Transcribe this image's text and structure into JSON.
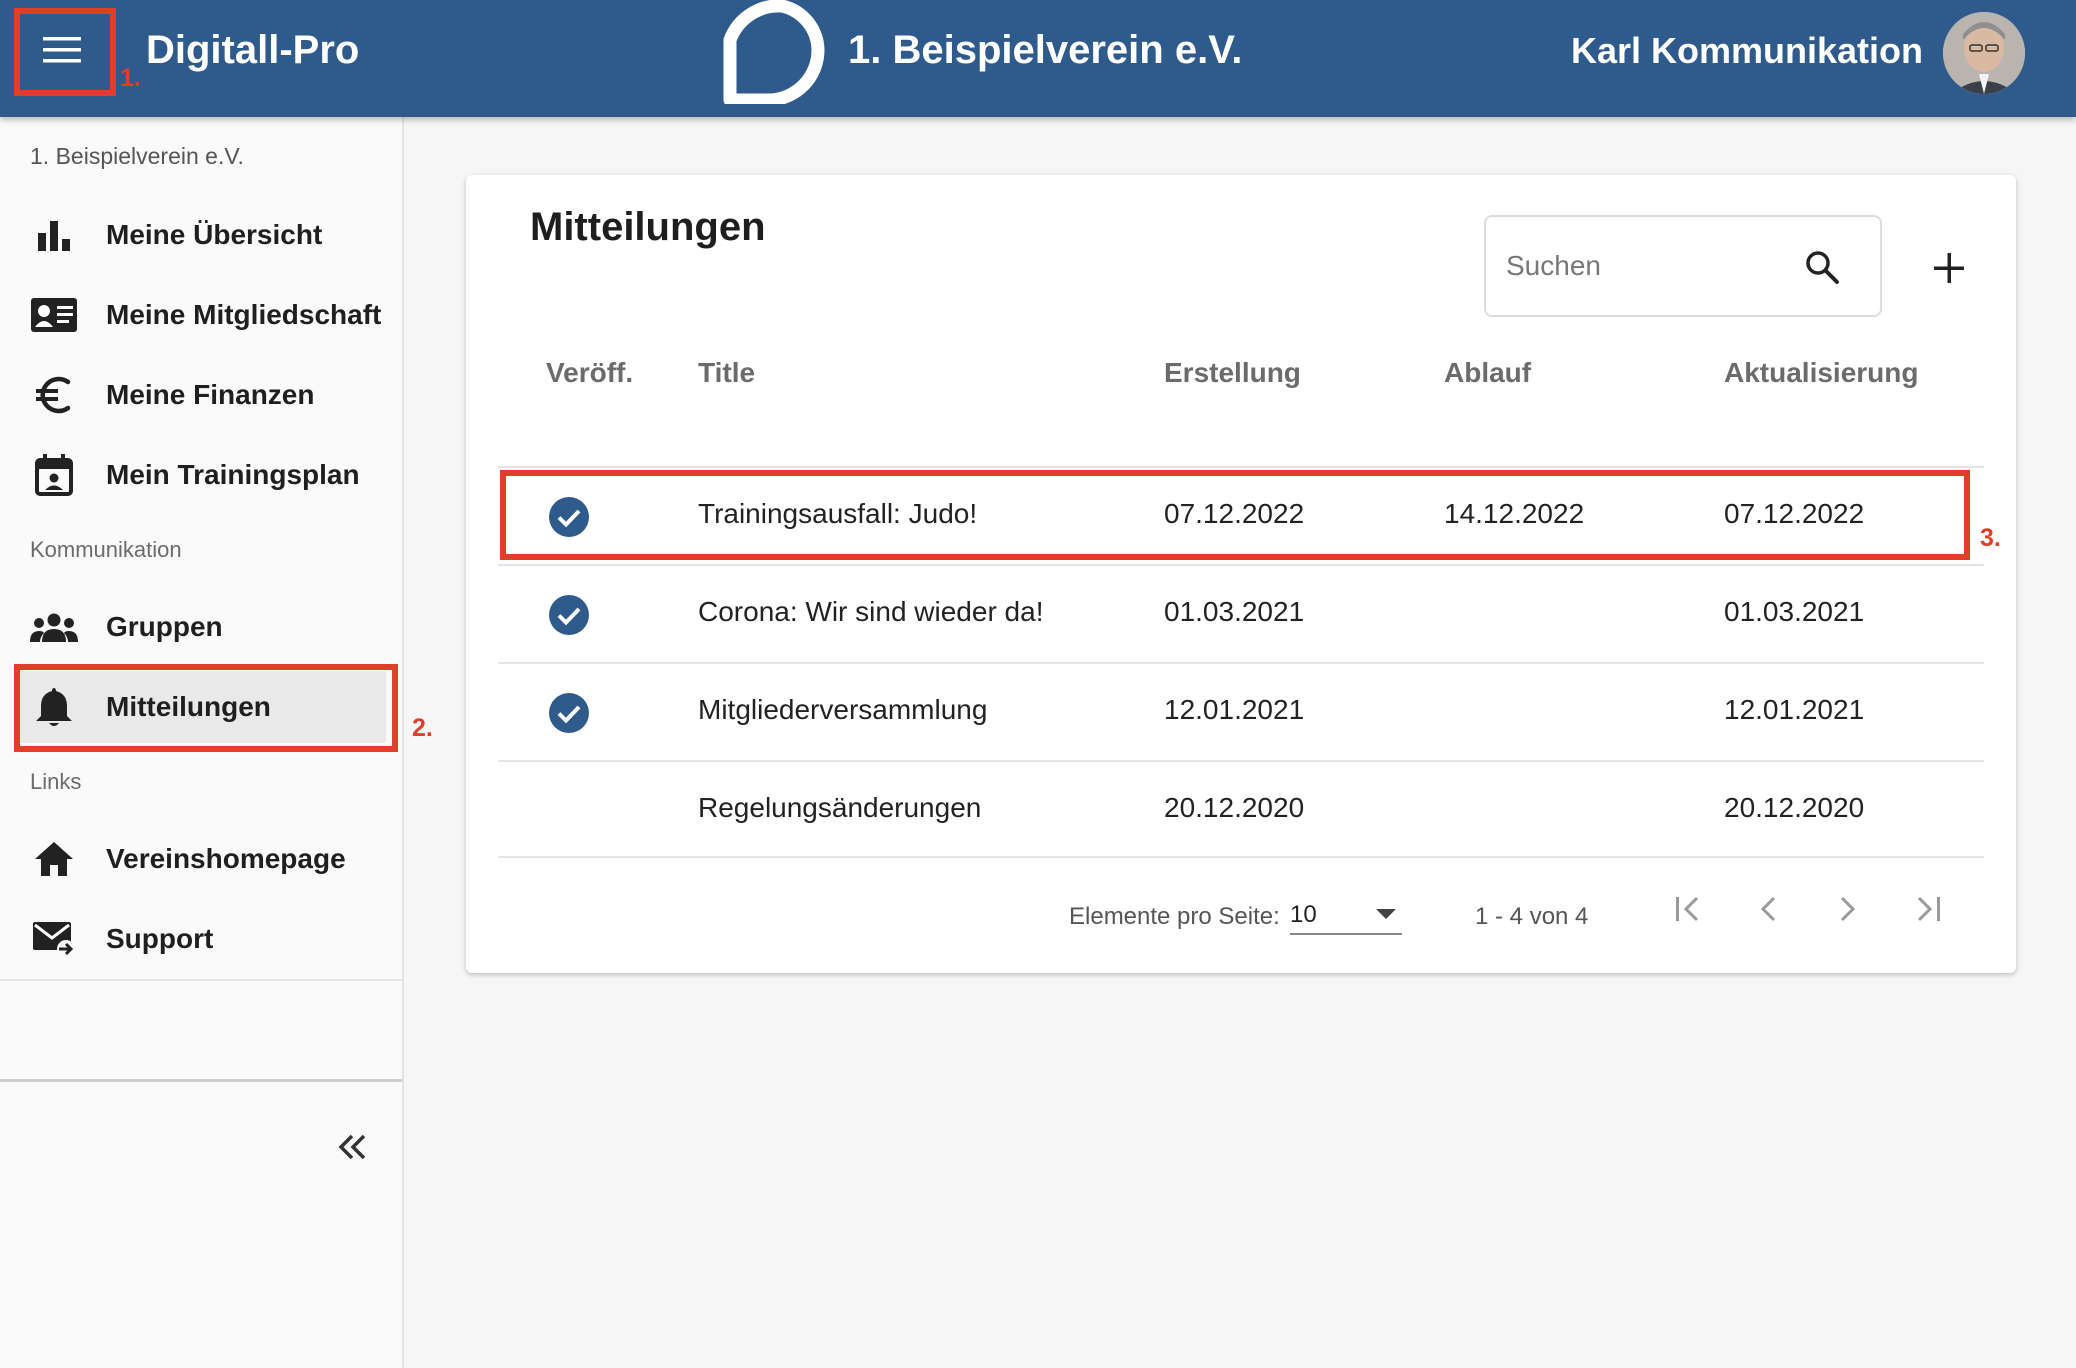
{
  "header": {
    "app_title": "Digitall-Pro",
    "club_title": "1. Beispielverein e.V.",
    "user_name": "Karl Kommunikation"
  },
  "sidebar": {
    "club_name": "1. Beispielverein e.V.",
    "items_main": [
      {
        "label": "Meine Übersicht",
        "icon": "bar-chart-icon"
      },
      {
        "label": "Meine Mitgliedschaft",
        "icon": "id-card-icon"
      },
      {
        "label": "Meine Finanzen",
        "icon": "euro-icon"
      },
      {
        "label": "Mein Trainingsplan",
        "icon": "calendar-icon"
      }
    ],
    "section_communication": "Kommunikation",
    "items_communication": [
      {
        "label": "Gruppen",
        "icon": "groups-icon"
      },
      {
        "label": "Mitteilungen",
        "icon": "bell-icon",
        "active": true
      }
    ],
    "section_links": "Links",
    "items_links": [
      {
        "label": "Vereinshomepage",
        "icon": "home-icon"
      },
      {
        "label": "Support",
        "icon": "mail-forward-icon"
      }
    ]
  },
  "annotations": [
    "1.",
    "2.",
    "3."
  ],
  "main": {
    "title": "Mitteilungen",
    "search": {
      "placeholder": "Suchen",
      "value": ""
    },
    "columns": [
      "Veröff.",
      "Title",
      "Erstellung",
      "Ablauf",
      "Aktualisierung"
    ],
    "rows": [
      {
        "published": true,
        "title": "Trainingsausfall: Judo!",
        "created": "07.12.2022",
        "expires": "14.12.2022",
        "updated": "07.12.2022"
      },
      {
        "published": true,
        "title": "Corona: Wir sind wieder da!",
        "created": "01.03.2021",
        "expires": "",
        "updated": "01.03.2021"
      },
      {
        "published": true,
        "title": "Mitgliederversammlung",
        "created": "12.01.2021",
        "expires": "",
        "updated": "12.01.2021"
      },
      {
        "published": false,
        "title": "Regelungsänderungen",
        "created": "20.12.2020",
        "expires": "",
        "updated": "20.12.2020"
      }
    ],
    "pagination": {
      "per_page_label": "Elemente pro Seite:",
      "per_page_value": "10",
      "range_text": "1 - 4 von 4"
    }
  },
  "colors": {
    "header_bg": "#2e5a8c",
    "annotation": "#e23d28",
    "check": "#2e5a8c"
  }
}
